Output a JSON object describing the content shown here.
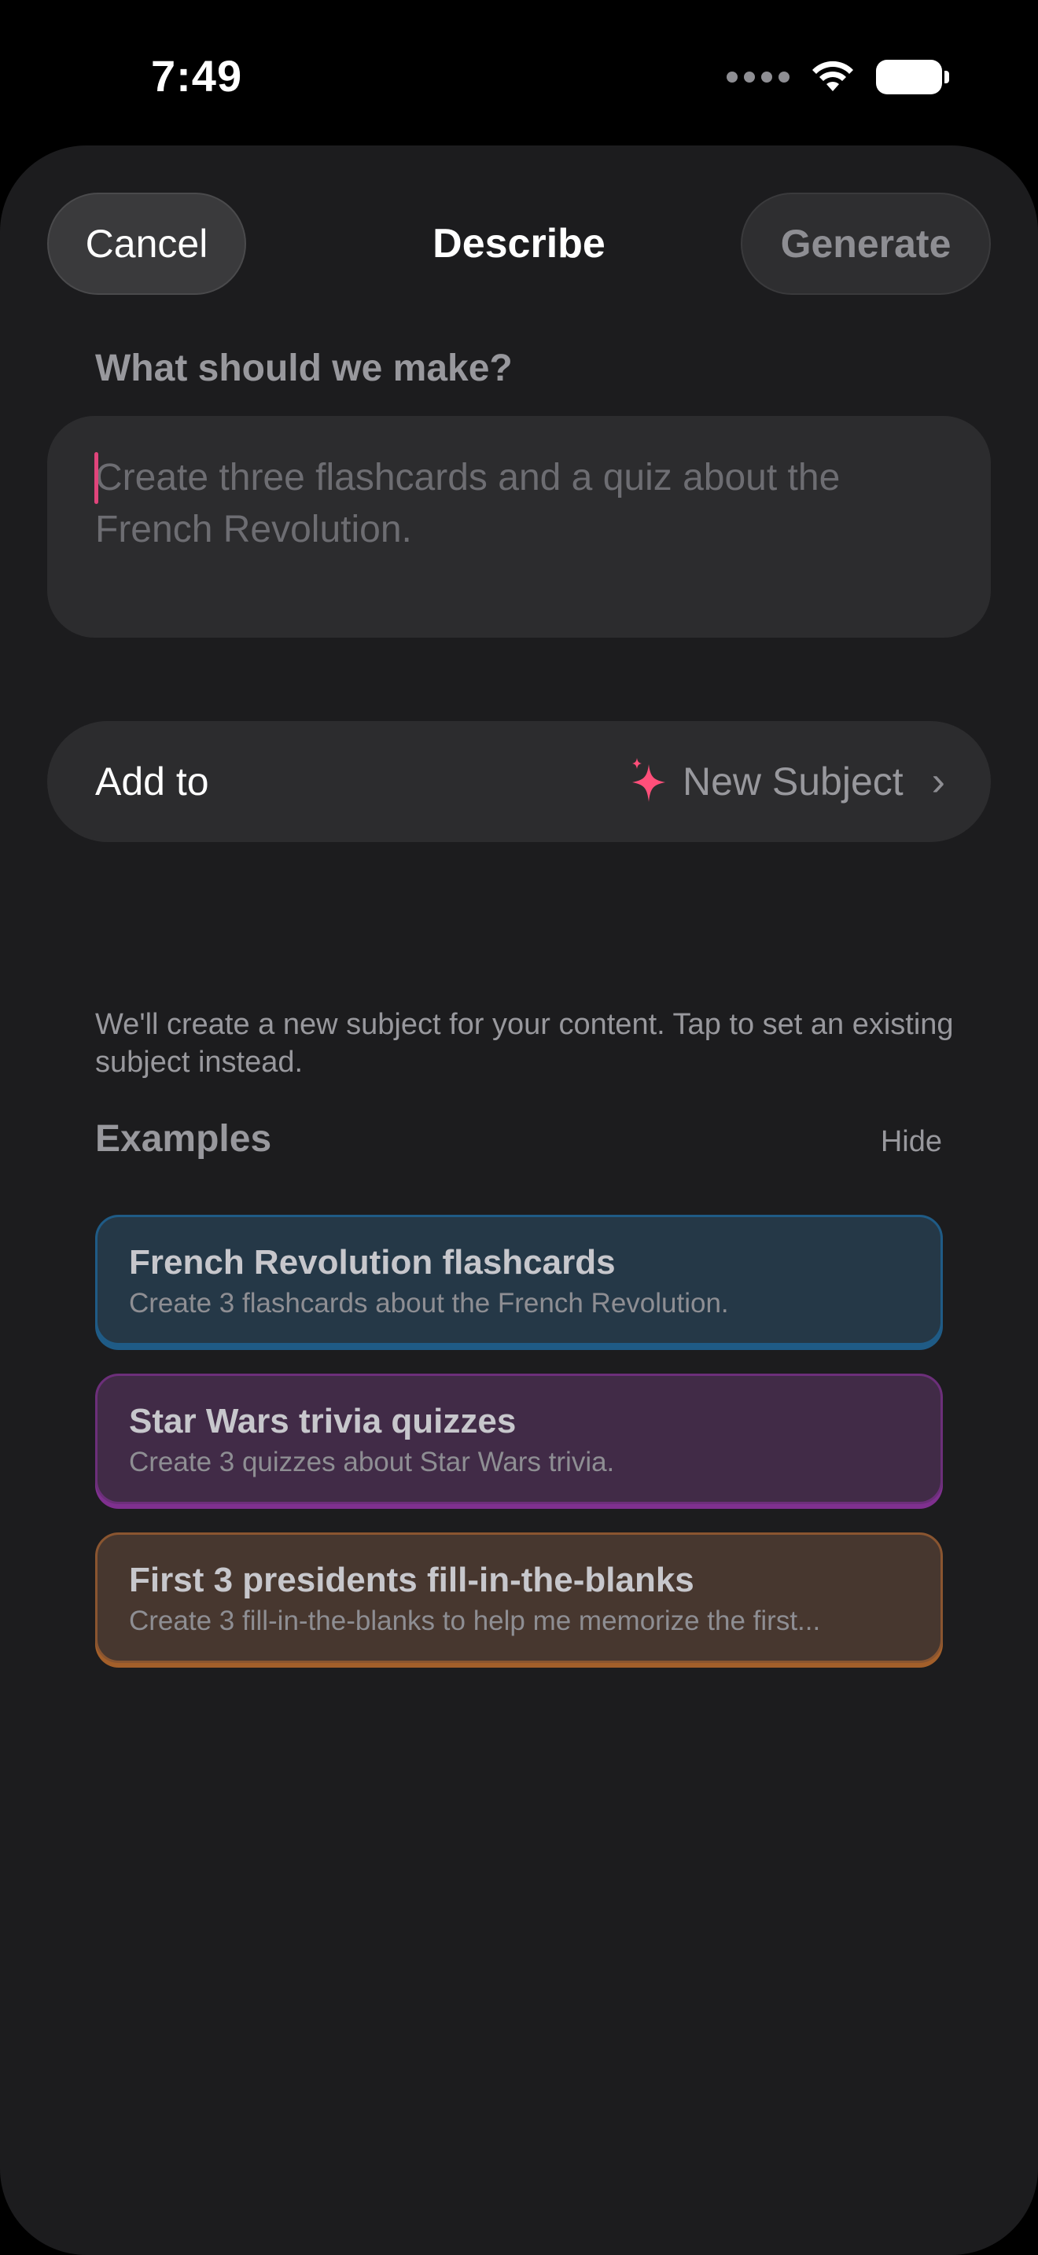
{
  "status_bar": {
    "time": "7:49",
    "icons": [
      "cellular-dots-icon",
      "wifi-icon",
      "battery-icon"
    ]
  },
  "header": {
    "cancel_label": "Cancel",
    "title": "Describe",
    "generate_label": "Generate"
  },
  "prompt": {
    "label": "What should we make?",
    "placeholder": "Create three flashcards and a quiz about the French Revolution.",
    "value": ""
  },
  "add_to": {
    "label": "Add to",
    "icon": "sparkles-icon",
    "value": "New Subject",
    "helper": "We'll create a new subject for your content. Tap to set an existing subject instead."
  },
  "examples": {
    "title": "Examples",
    "hide_label": "Hide",
    "items": [
      {
        "title": "French Revolution flashcards",
        "description": "Create 3 flashcards about the French Revolution.",
        "color": "#1f5b86"
      },
      {
        "title": "Star Wars trivia quizzes",
        "description": "Create 3 quizzes about Star Wars trivia.",
        "color": "#7f308f"
      },
      {
        "title": "First 3 presidents fill-in-the-blanks",
        "description": "Create 3 fill-in-the-blanks to help me memorize the first...",
        "color": "#a35f2a"
      }
    ]
  },
  "colors": {
    "accent": "#e0457b",
    "sheet_background": "#1c1c1e"
  }
}
